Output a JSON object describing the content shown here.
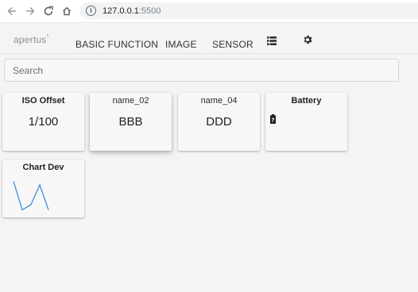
{
  "browser": {
    "back_icon": "arrow-left-icon",
    "forward_icon": "arrow-right-icon",
    "reload_icon": "reload-icon",
    "home_icon": "home-icon",
    "info_icon": "info-icon",
    "info_glyph": "i",
    "url_host": "127.0.0.1",
    "url_port": ":5500"
  },
  "header": {
    "logo_text": "apertus",
    "logo_mark": "°",
    "nav": [
      {
        "label": "BASIC FUNCTION"
      },
      {
        "label": "IMAGE"
      },
      {
        "label": "SENSOR"
      }
    ],
    "list_icon": "list-icon",
    "settings_icon": "gear-icon"
  },
  "search": {
    "placeholder": "Search",
    "value": ""
  },
  "cards": [
    {
      "title": "ISO Offset",
      "value": "1/100"
    },
    {
      "title": "name_02",
      "value": "BBB"
    },
    {
      "title": "name_04",
      "value": "DDD"
    },
    {
      "title": "Battery",
      "icon": "battery-unknown-icon",
      "icon_glyph": "?"
    }
  ],
  "chart_card": {
    "title": "Chart Dev"
  },
  "chart_data": {
    "type": "line",
    "title": "",
    "xlabel": "",
    "ylabel": "",
    "x": [
      0,
      1,
      2,
      3,
      4
    ],
    "series": [
      {
        "values": [
          9,
          1,
          2.5,
          8,
          1
        ]
      }
    ],
    "ylim": [
      0,
      10
    ],
    "color": "#2e86de",
    "grid": false
  },
  "colors": {
    "accent_logo_mark": "#e8752a",
    "chart_line": "#2e86de"
  }
}
